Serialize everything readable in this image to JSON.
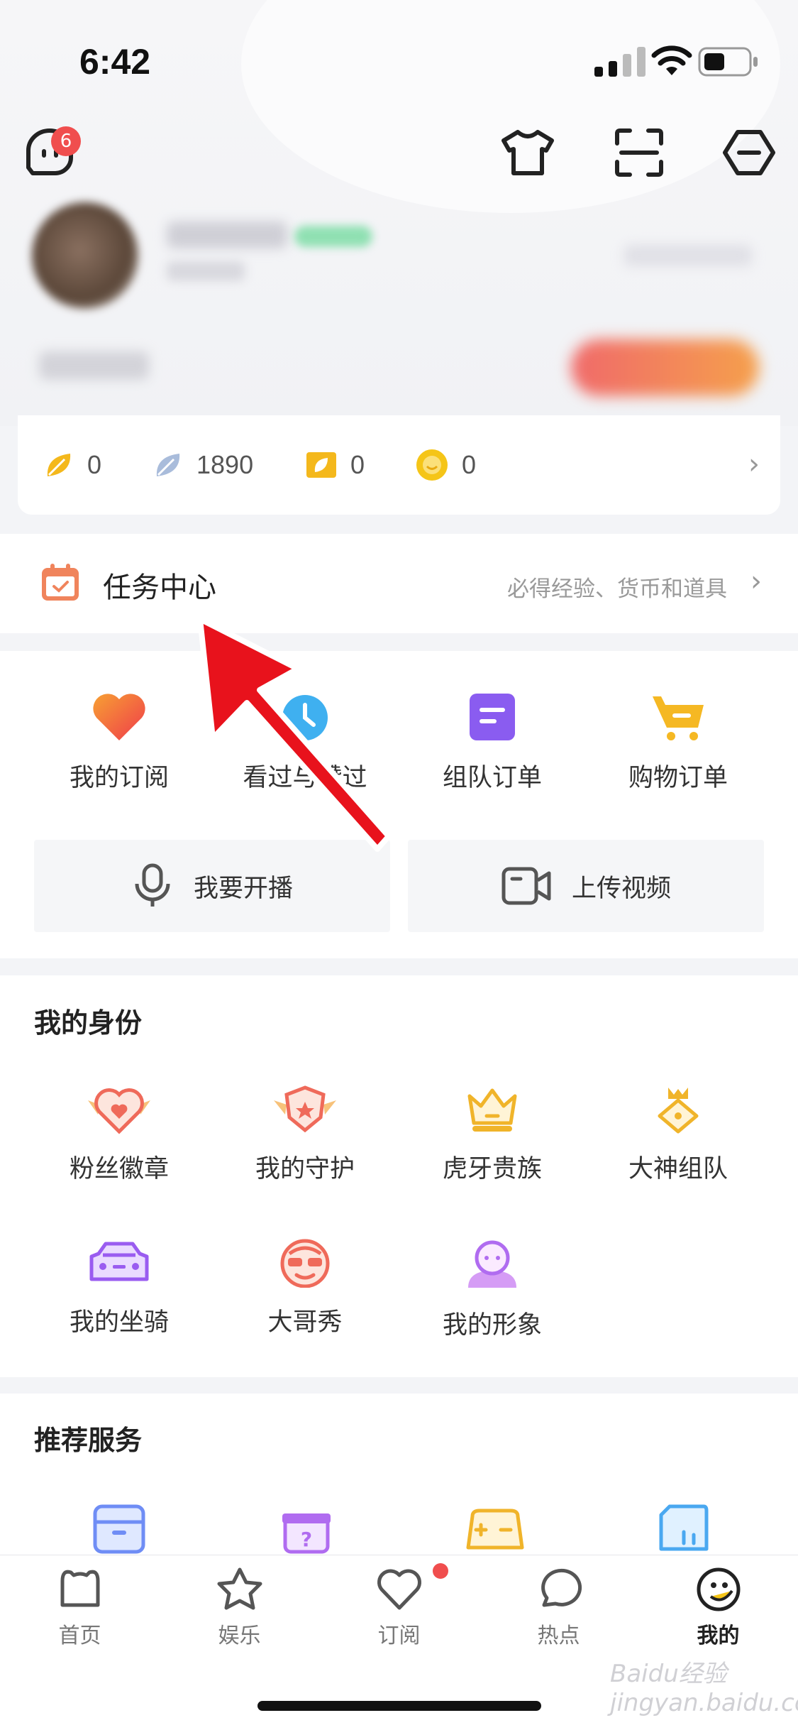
{
  "status": {
    "time": "6:42"
  },
  "header": {
    "notification_count": "6"
  },
  "assets": [
    {
      "icon": "gold-leaf-icon",
      "value": "0",
      "color": "#f4b81c"
    },
    {
      "icon": "silver-leaf-icon",
      "value": "1890",
      "color": "#9fb4d6"
    },
    {
      "icon": "ticket-icon",
      "value": "0",
      "color": "#f4b81c"
    },
    {
      "icon": "coin-icon",
      "value": "0",
      "color": "#f4c419"
    }
  ],
  "task_center": {
    "title": "任务中心",
    "subtitle": "必得经验、货币和道具"
  },
  "quick_entries": [
    {
      "label": "我的订阅",
      "icon": "heart-icon"
    },
    {
      "label": "看过与赞过",
      "icon": "clock-icon"
    },
    {
      "label": "组队订单",
      "icon": "order-icon"
    },
    {
      "label": "购物订单",
      "icon": "cart-icon"
    }
  ],
  "actions": {
    "live": "我要开播",
    "upload": "上传视频"
  },
  "identity": {
    "title": "我的身份",
    "items": [
      {
        "label": "粉丝徽章",
        "icon": "fan-badge-icon"
      },
      {
        "label": "我的守护",
        "icon": "guard-icon"
      },
      {
        "label": "虎牙贵族",
        "icon": "crown-icon"
      },
      {
        "label": "大神组队",
        "icon": "master-icon"
      },
      {
        "label": "我的坐骑",
        "icon": "car-icon"
      },
      {
        "label": "大哥秀",
        "icon": "face-icon"
      },
      {
        "label": "我的形象",
        "icon": "avatar-icon"
      }
    ]
  },
  "recommend": {
    "title": "推荐服务"
  },
  "tabs": [
    {
      "label": "首页",
      "icon": "home-icon"
    },
    {
      "label": "娱乐",
      "icon": "star-icon"
    },
    {
      "label": "订阅",
      "icon": "heart-outline-icon"
    },
    {
      "label": "热点",
      "icon": "chat-icon"
    },
    {
      "label": "我的",
      "icon": "me-icon"
    }
  ],
  "watermark": "Baidu经验 jingyan.baidu.com"
}
